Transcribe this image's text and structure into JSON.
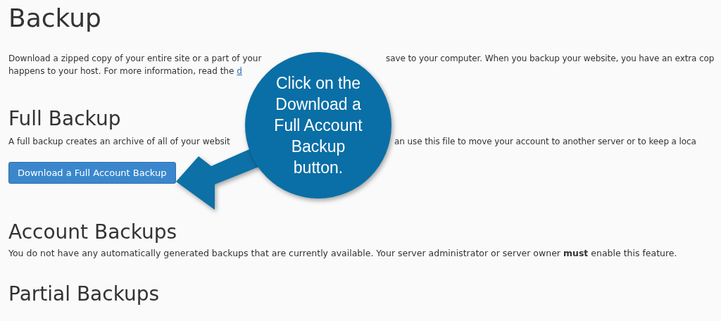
{
  "page_title": "Backup",
  "intro": {
    "line_1_left": "Download a zipped copy of your entire site or a part of your",
    "line_1_right": "save to your computer. When you backup your website, you have an extra cop",
    "line_2": "happens to your host. For more information, read the",
    "link": "d"
  },
  "full_backup": {
    "heading": "Full Backup",
    "text_left": "A full backup creates an archive of all of your websit",
    "text_right": "an use this file to move your account to another server or to keep a loca",
    "button": "Download a Full Account Backup"
  },
  "account_backups": {
    "heading": "Account Backups",
    "text": "You do not have any automatically generated backups that are currently available. Your server administrator or server owner **must** enable this feature."
  },
  "partial_backups": {
    "heading": "Partial Backups"
  },
  "callout": {
    "lines": [
      "Click on the",
      "Download a",
      "Full Account",
      "Backup",
      "button."
    ]
  }
}
